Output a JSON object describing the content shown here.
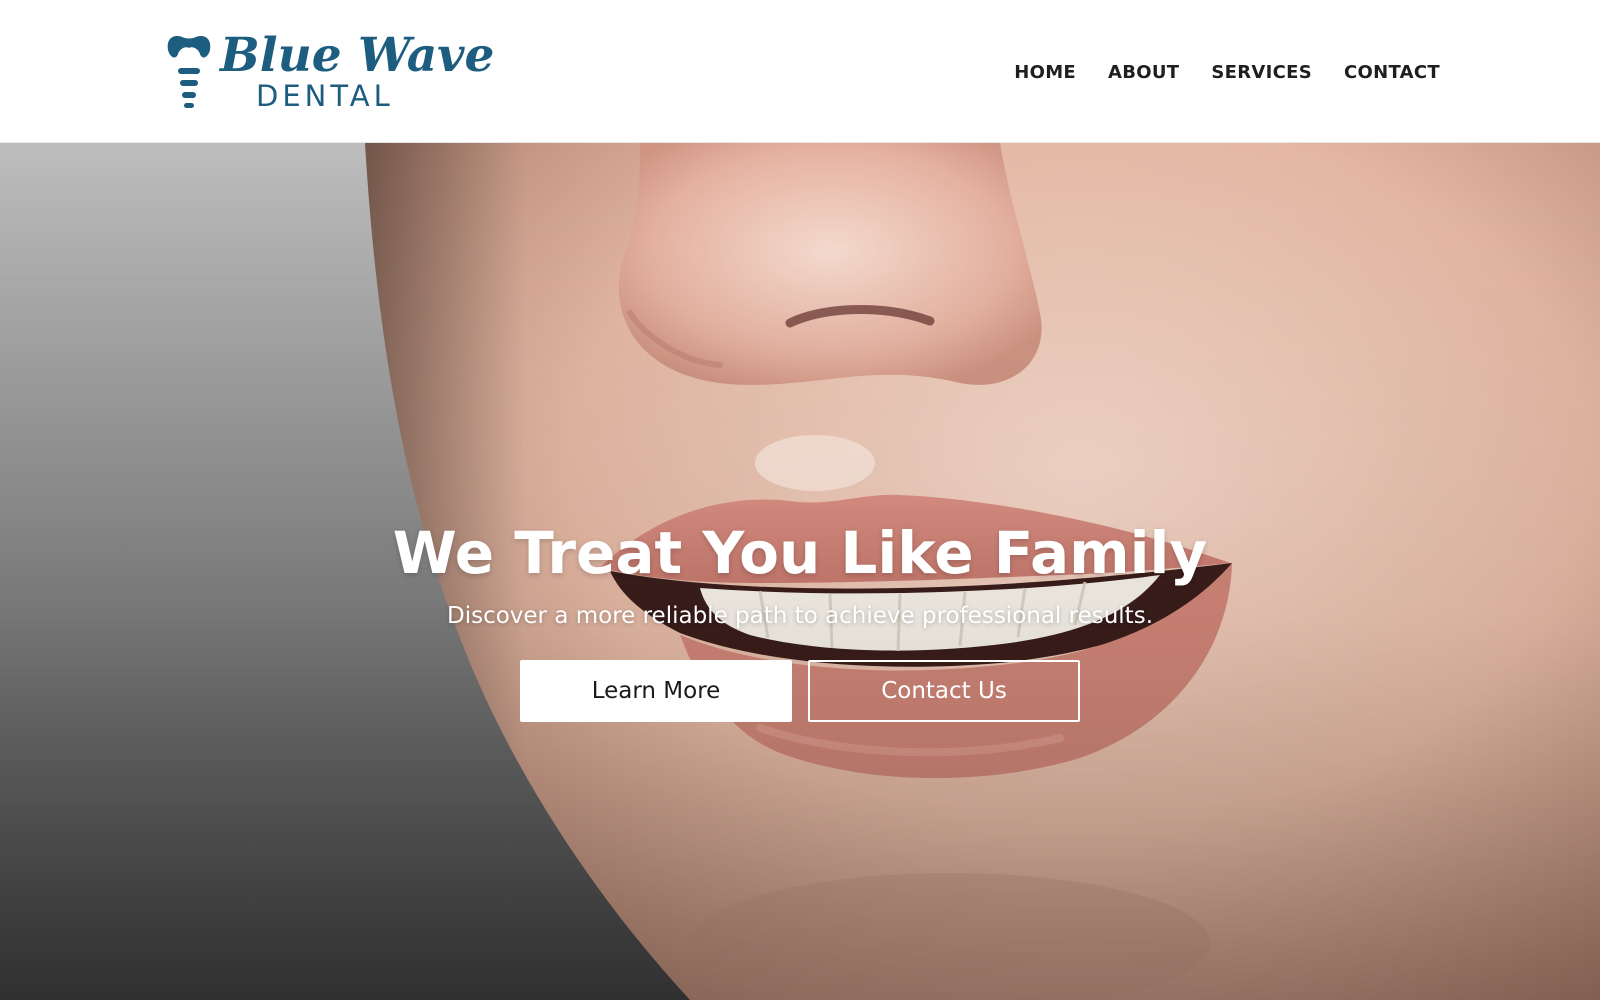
{
  "brand": {
    "name_script": "Blue Wave",
    "name_word": "DENTAL",
    "logo_icon": "tooth-implant-icon",
    "color": "#1d5d7f"
  },
  "nav": {
    "items": [
      {
        "label": "HOME"
      },
      {
        "label": "ABOUT"
      },
      {
        "label": "SERVICES"
      },
      {
        "label": "CONTACT"
      }
    ]
  },
  "hero": {
    "title": "We Treat You Like Family",
    "subtitle": "Discover a more reliable path to achieve professional results.",
    "primary_button": "Learn More",
    "secondary_button": "Contact Us",
    "background": "smiling-face-closeup-photo"
  }
}
